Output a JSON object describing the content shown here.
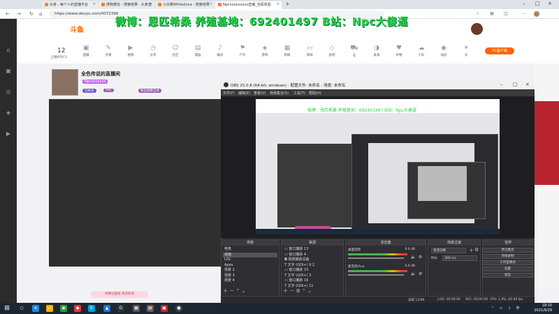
{
  "browser": {
    "tabs": [
      {
        "label": "头条 - 每个人的直播平台"
      },
      {
        "label": "搜狗微信 - 搜索结果 - 头条直"
      },
      {
        "label": "小白菜White2ova - 搜索结果"
      },
      {
        "label": "Npcxxxxxxxxx直播_全民体验"
      }
    ],
    "url": "https://www.douyu.com/4072396"
  },
  "watermark": "微博：恩匹希桑 养殖基地：692401497 B站：Npc大傻逼",
  "site": {
    "logo": "斗鱼",
    "follow_count": "12",
    "follow_label": "上播时间(1)",
    "categories": [
      "直播",
      "文章",
      "视频",
      "分享",
      "社区",
      "漫画",
      "娱乐",
      "户外",
      "游戏",
      "新闻",
      "商城",
      "鱼吧",
      "车",
      "美食",
      "好物",
      "小队",
      "动态",
      "天",
      "颜值"
    ],
    "pc_client": "PC客户端"
  },
  "room": {
    "title": "全色传说的直播间",
    "streamer": "Npcxxxxxxx",
    "badge1": "已关注",
    "badge2": "ABC",
    "badge3": "粉丝勋章全体",
    "chat_pill": "弹幕拉截图 来源频道"
  },
  "obs": {
    "title": "OBS 25.0.8 (64-bit, windows) - 配置文件: 未命名 - 场景: 未命名",
    "menu": [
      "文件(F)",
      "编辑(E)",
      "查看(V)",
      "场景集合(S)",
      "工具(T)",
      "帮助(H)"
    ],
    "preview_watermark": "微博：恩匹希桑 养殖基地：692401497 B站：Npc大傻逼",
    "docks": {
      "scenes": {
        "title": "场景",
        "items": [
          "电竞",
          "桌面",
          "LOL",
          "Apex",
          "场景 2",
          "场景 3",
          "场景 4"
        ],
        "selected": 1
      },
      "sources": {
        "title": "来源",
        "items": [
          "窗口捕获 13",
          "窗口捕获 4",
          "视频捕获设备",
          "文字 (GDI+) 9 2",
          "窗口捕获 15",
          "文字 (GDI+) 3",
          "窗口捕获 16",
          "文字 (GDI+) 11"
        ]
      },
      "mixer": {
        "title": "混音器",
        "rows": [
          {
            "name": "桌面音频",
            "db": "0.0 dB"
          },
          {
            "name": "麦克风/Aux",
            "db": "0.0 dB"
          }
        ]
      },
      "transitions": {
        "title": "场景过渡",
        "type": "渐变切换",
        "duration_label": "时长",
        "duration": "300 ms"
      },
      "controls": {
        "title": "控件",
        "buttons": [
          "停止推流",
          "开始录制",
          "工作室模式",
          "设置",
          "退出"
        ]
      }
    },
    "status": {
      "dropped": "丢帧 12/98",
      "live": "LIVE: 00:00:00",
      "rec": "REC: 00:00:00",
      "cpu": "CPU: 1.9%, 60.00 fps"
    }
  },
  "taskbar": {
    "time": "19:10",
    "date": "2021/9/29"
  }
}
